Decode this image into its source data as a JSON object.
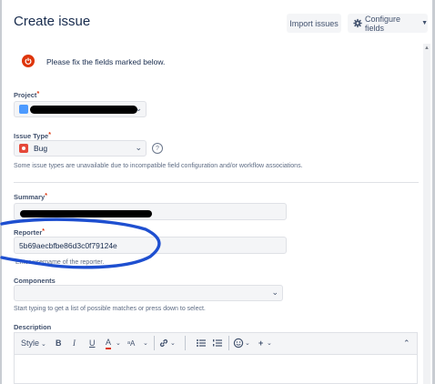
{
  "dialog": {
    "title": "Create issue",
    "import_label": "Import issues",
    "configure_label": "Configure fields",
    "error_message": "Please fix the fields marked below."
  },
  "fields": {
    "project_label": "Project",
    "issue_type_label": "Issue Type",
    "issue_type_value": "Bug",
    "issue_type_hint": "Some issue types are unavailable due to incompatible field configuration and/or workflow associations.",
    "summary_label": "Summary",
    "reporter_label": "Reporter",
    "reporter_value": "5b69aecbfbe86d3c0f79124e",
    "reporter_hint": "Enter username of the reporter.",
    "components_label": "Components",
    "components_hint": "Start typing to get a list of possible matches or press down to select.",
    "description_label": "Description",
    "required_marker": "*"
  },
  "editor_toolbar": {
    "style_label": "Style",
    "bold": "B",
    "italic": "I",
    "underline": "U",
    "text_color": "A",
    "more_format": "ᵃA",
    "insert": "+"
  },
  "colors": {
    "required": "#de350b",
    "annotation": "#1e4fd0",
    "field_bg": "#f4f5f7"
  },
  "icons": [
    "gear-icon",
    "error-icon",
    "project-avatar-icon",
    "bug-icon",
    "help-icon",
    "link-icon",
    "bullet-list-icon",
    "numbered-list-icon",
    "emoji-icon",
    "collapse-icon"
  ]
}
